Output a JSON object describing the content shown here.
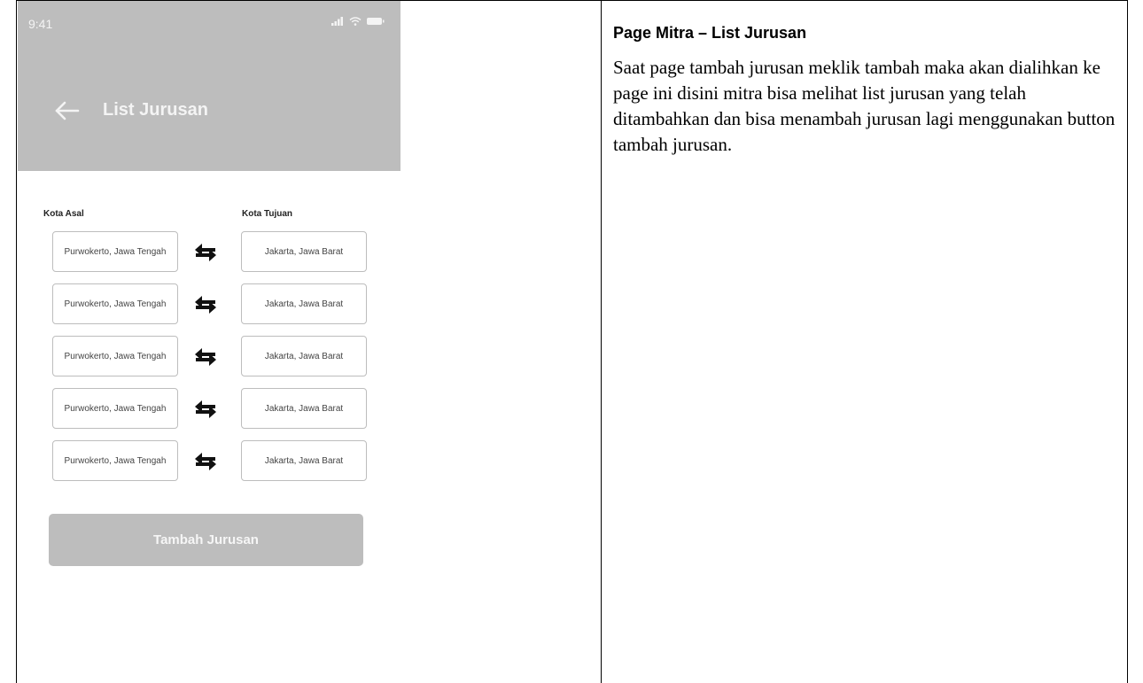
{
  "phone": {
    "status_time": "9:41",
    "title": "List Jurusan",
    "labels": {
      "asal": "Kota Asal",
      "tujuan": "Kota Tujuan"
    },
    "routes": [
      {
        "asal": "Purwokerto, Jawa Tengah",
        "tujuan": "Jakarta, Jawa Barat"
      },
      {
        "asal": "Purwokerto, Jawa Tengah",
        "tujuan": "Jakarta, Jawa Barat"
      },
      {
        "asal": "Purwokerto, Jawa Tengah",
        "tujuan": "Jakarta, Jawa Barat"
      },
      {
        "asal": "Purwokerto, Jawa Tengah",
        "tujuan": "Jakarta, Jawa Barat"
      },
      {
        "asal": "Purwokerto, Jawa Tengah",
        "tujuan": "Jakarta, Jawa Barat"
      }
    ],
    "add_button_label": "Tambah Jurusan",
    "icons": {
      "back": "arrow-left-icon",
      "swap": "swap-arrows-icon",
      "signal": "signal-icon",
      "wifi": "wifi-icon",
      "battery": "battery-icon"
    },
    "colors": {
      "appbar": "#bdbdbd",
      "button": "#bdbdbd"
    }
  },
  "doc": {
    "title": "Page Mitra – List Jurusan",
    "body": "Saat page tambah jurusan meklik tambah maka akan dialihkan ke page ini disini mitra bisa melihat list jurusan yang telah ditambahkan dan bisa menambah jurusan lagi menggunakan button tambah jurusan."
  }
}
